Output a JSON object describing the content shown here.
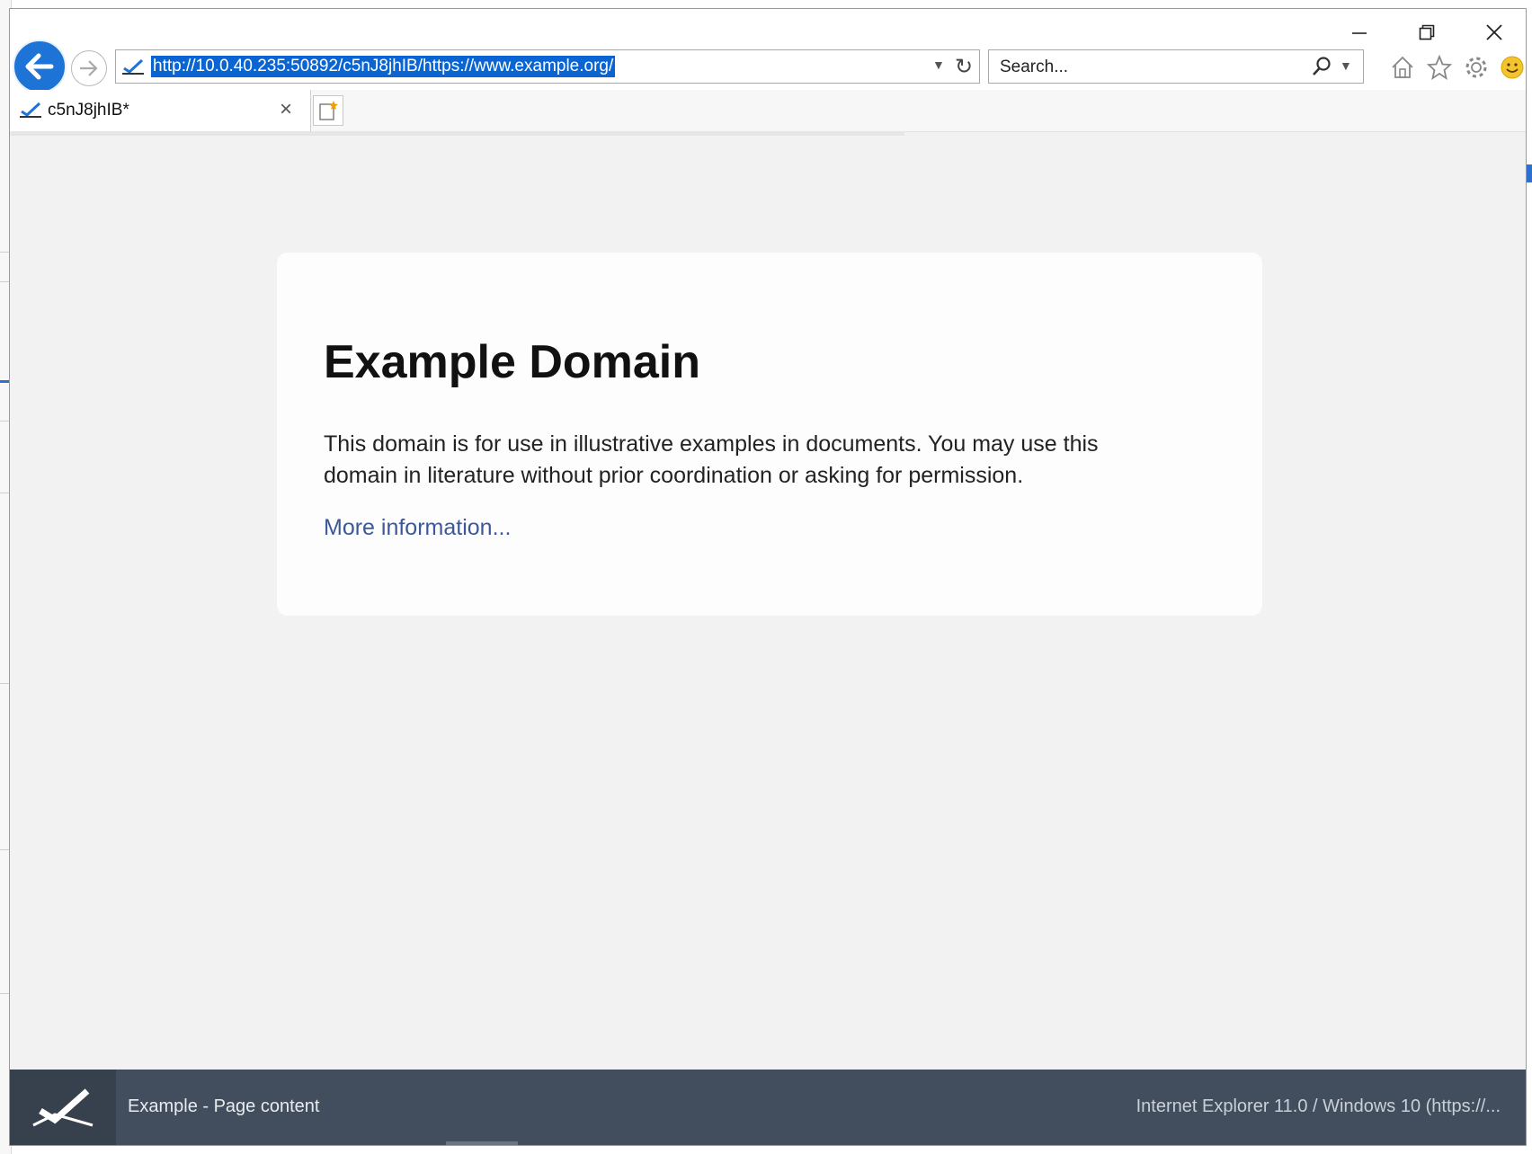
{
  "browser": {
    "address_url": "http://10.0.40.235:50892/c5nJ8jhIB/https://www.example.org/",
    "search_placeholder": "Search...",
    "tab_title": "c5nJ8jhIB*"
  },
  "page": {
    "heading": "Example Domain",
    "paragraph": "This domain is for use in illustrative examples in documents. You may use this domain in literature without prior coordination or asking for permission.",
    "link_text": "More information..."
  },
  "statusbar": {
    "left_text": "Example - Page content",
    "right_text": "Internet Explorer 11.0 / Windows 10 (https://..."
  },
  "icons": [
    "back-arrow-icon",
    "forward-arrow-icon",
    "site-icon",
    "dropdown-icon",
    "refresh-icon",
    "search-icon",
    "home-icon",
    "star-icon",
    "gear-icon",
    "smiley-icon",
    "close-icon",
    "new-tab-icon",
    "minimize-icon",
    "maximize-icon",
    "window-close-icon"
  ],
  "colors": {
    "accent": "#1e74d6",
    "selection": "#0a64d2",
    "link": "#3b5998",
    "statusbar": "#424e5d"
  }
}
